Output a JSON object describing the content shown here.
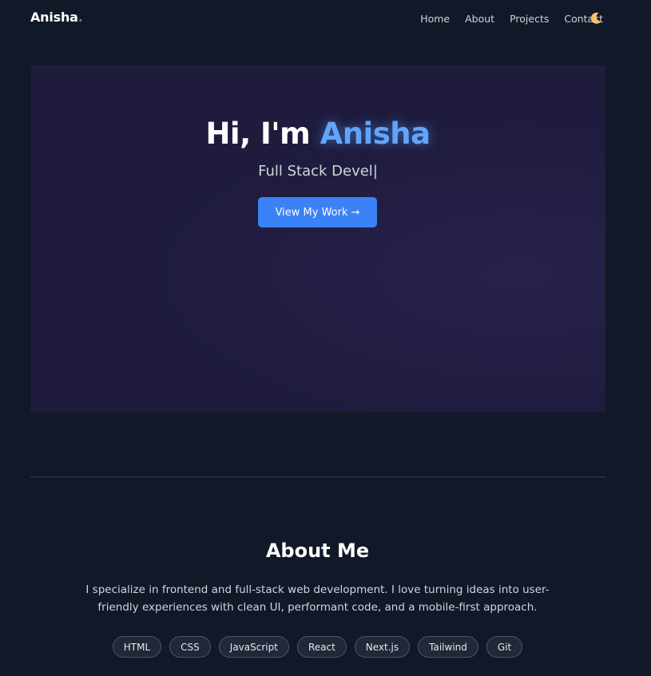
{
  "nav": {
    "logo": "Anisha",
    "logo_dot": ".",
    "links": [
      "Home",
      "About",
      "Projects",
      "Contact"
    ],
    "theme_icon": "crescent-moon-icon"
  },
  "hero": {
    "greeting": "Hi, I'm ",
    "name": "Anisha",
    "subtitle": "Full Stack Devel",
    "caret": "|",
    "cta_label": "View My Work",
    "cta_arrow": "→"
  },
  "about": {
    "title": "About Me",
    "text": "I specialize in frontend and full-stack web development. I love turning ideas into user-friendly experiences with clean UI, performant code, and a mobile-first approach.",
    "skills": [
      "HTML",
      "CSS",
      "JavaScript",
      "React",
      "Next.js",
      "Tailwind",
      "Git"
    ]
  },
  "colors": {
    "accent": "#3b82f6",
    "background": "#111827",
    "hero_bg": "#1e1b3d"
  }
}
